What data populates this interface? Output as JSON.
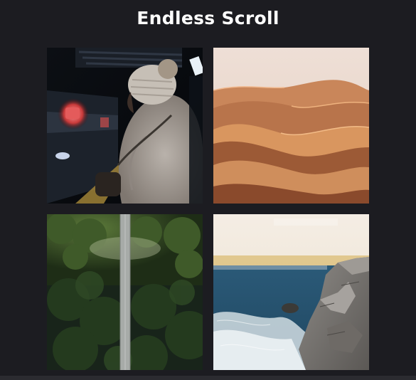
{
  "page": {
    "title": "Endless Scroll",
    "background": "#1c1c21"
  },
  "gallery": {
    "items": [
      {
        "subject": "subway-platform-person-in-hat"
      },
      {
        "subject": "desert-sand-dunes"
      },
      {
        "subject": "forest-suspension-bridge-aerial"
      },
      {
        "subject": "rocky-coastline-ocean"
      }
    ]
  }
}
